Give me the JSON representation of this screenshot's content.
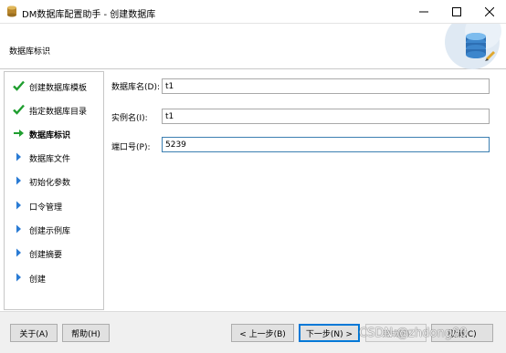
{
  "window": {
    "title": "DM数据库配置助手 - 创建数据库",
    "icon": "dm-app-icon",
    "controls": {
      "minimize": "minimize-icon",
      "maximize": "maximize-icon",
      "close": "close-icon"
    }
  },
  "header": {
    "title": "数据库标识",
    "art": "database-graphic"
  },
  "sidebar": {
    "steps": [
      {
        "label": "创建数据库模板",
        "state": "done"
      },
      {
        "label": "指定数据库目录",
        "state": "done"
      },
      {
        "label": "数据库标识",
        "state": "current"
      },
      {
        "label": "数据库文件",
        "state": "pending"
      },
      {
        "label": "初始化参数",
        "state": "pending"
      },
      {
        "label": "口令管理",
        "state": "pending"
      },
      {
        "label": "创建示例库",
        "state": "pending"
      },
      {
        "label": "创建摘要",
        "state": "pending"
      },
      {
        "label": "创建",
        "state": "pending"
      }
    ]
  },
  "form": {
    "db_name": {
      "label": "数据库名(D):",
      "value": "t1"
    },
    "instance_name": {
      "label": "实例名(I):",
      "value": "t1"
    },
    "port": {
      "label": "端口号(P):",
      "value": "5239"
    }
  },
  "footer": {
    "about": "关于(A)",
    "help": "帮助(H)",
    "prev": "< 上一步(B)",
    "next": "下一步(N) >",
    "finish": "完成(F)",
    "cancel": "取消(C)"
  },
  "watermark": "CSDN @zhdong00",
  "colors": {
    "check": "#1f9e2f",
    "current_arrow": "#1f9e2f",
    "pending_arrow": "#2a7bd4",
    "focus": "#0078d7"
  }
}
